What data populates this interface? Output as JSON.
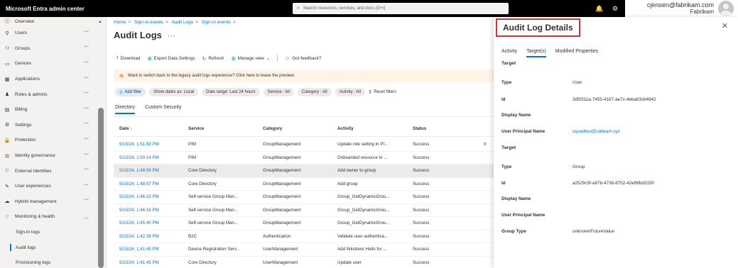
{
  "topbar": {
    "brand": "Microsoft Entra admin center",
    "search_placeholder": "Search resources, services, and docs (G+/)",
    "user_email": "cjensen@fabrikam.com",
    "user_org": "Fabrikam"
  },
  "sidebar": {
    "items": [
      {
        "label": "Overview",
        "icon": "info-icon",
        "glyph": "ⓘ",
        "chevron": false
      },
      {
        "label": "Users",
        "icon": "user-icon",
        "glyph": "⚲",
        "chevron": true
      },
      {
        "label": "Groups",
        "icon": "groups-icon",
        "glyph": "⚇",
        "chevron": true
      },
      {
        "label": "Devices",
        "icon": "devices-icon",
        "glyph": "▭",
        "chevron": true
      },
      {
        "label": "Applications",
        "icon": "applications-icon",
        "glyph": "▦",
        "chevron": true
      },
      {
        "label": "Roles & admins",
        "icon": "roles-icon",
        "glyph": "♟",
        "chevron": true
      },
      {
        "label": "Billing",
        "icon": "billing-icon",
        "glyph": "▤",
        "chevron": true
      },
      {
        "label": "Settings",
        "icon": "settings-icon",
        "glyph": "⚙",
        "chevron": true
      },
      {
        "label": "Protection",
        "icon": "protection-icon",
        "glyph": "🔒",
        "chevron": true
      },
      {
        "label": "Identity governance",
        "icon": "governance-icon",
        "glyph": "⚖",
        "chevron": true
      },
      {
        "label": "External Identities",
        "icon": "external-identities-icon",
        "glyph": "⚐",
        "chevron": true
      },
      {
        "label": "User experiences",
        "icon": "user-experiences-icon",
        "glyph": "✎",
        "chevron": true
      },
      {
        "label": "Hybrid management",
        "icon": "hybrid-icon",
        "glyph": "☁",
        "chevron": true
      },
      {
        "label": "Monitoring & health",
        "icon": "monitoring-icon",
        "glyph": "♡",
        "chevron": true,
        "expanded": true
      }
    ],
    "subitems": [
      "Sign-in logs",
      "Audit logs",
      "Provisioning logs"
    ]
  },
  "main": {
    "breadcrumb": [
      "Home",
      "Sign-in events",
      "Audit Logs",
      "Sign-in events"
    ],
    "title": "Audit Logs",
    "toolbar": {
      "download": "Download",
      "export": "Export Data Settings",
      "refresh": "Refresh",
      "manage_view": "Manage view",
      "feedback": "Got feedback?"
    },
    "banner": "Want to switch back to the legacy audit logs experience? Click here to leave the preview.",
    "filters": {
      "add": "Add filter",
      "show_dates": "Show dates as: Local",
      "date_range": "Date range: Last 24 hours",
      "service": "Service : All",
      "category": "Category : All",
      "activity": "Activity : All",
      "reset": "Reset filters"
    },
    "tabs": [
      "Directory",
      "Custom Security"
    ],
    "table": {
      "headers": [
        "Date ↓",
        "Service",
        "Category",
        "Activity",
        "Status"
      ],
      "rows": [
        [
          "5/15/24, 1:51:59 PM",
          "PIM",
          "GroupManagement",
          "Update role setting in PI...",
          "Success",
          "Ir"
        ],
        [
          "5/15/24, 1:50:14 PM",
          "PIM",
          "GroupManagement",
          "Onboarded resource to ...",
          "Success",
          ""
        ],
        [
          "5/15/24, 1:48:09 PM",
          "Core Directory",
          "GroupManagement",
          "Add owner to group",
          "Success",
          ""
        ],
        [
          "5/15/24, 1:48:07 PM",
          "Core Directory",
          "GroupManagement",
          "Add group",
          "Success",
          ""
        ],
        [
          "5/15/24, 1:46:19 PM",
          "Self-service Group Man...",
          "GroupManagement",
          "Group_GetDynamicGrou...",
          "Success",
          ""
        ],
        [
          "5/15/24, 1:46:16 PM",
          "Self-service Group Man...",
          "GroupManagement",
          "Group_GetDynamicGrou...",
          "Success",
          ""
        ],
        [
          "5/15/24, 1:45:40 PM",
          "Self-service Group Man...",
          "GroupManagement",
          "Group_GetDynamicGrou...",
          "Success",
          ""
        ],
        [
          "5/15/24, 1:42:28 PM",
          "B2C",
          "Authentication",
          "Validate user authentica...",
          "Success",
          ""
        ],
        [
          "5/15/24, 1:41:45 PM",
          "Device Registration Serv...",
          "UserManagement",
          "Add Windows Hello for ...",
          "Success",
          ""
        ],
        [
          "5/15/24, 1:41:45 PM",
          "Core Directory",
          "UserManagement",
          "Update user",
          "Success",
          ""
        ]
      ],
      "selected_row": 2
    }
  },
  "panel": {
    "title": "Audit Log Details",
    "tabs": [
      "Activity",
      "Target(s)",
      "Modified Properties"
    ],
    "active_tab": 1,
    "sections": [
      {
        "heading": "Target",
        "rows": [
          {
            "label": "Type",
            "value": "User"
          },
          {
            "label": "Id",
            "value": "3d5f311a-7455-4167-ae7c-4eba03cb4942"
          },
          {
            "label": "Display Name",
            "value": ""
          },
          {
            "label": "User Principal Name",
            "value": "squadtwo@catteam.xyz",
            "link": true
          }
        ]
      },
      {
        "heading": "Target",
        "rows": [
          {
            "label": "Type",
            "value": "Group"
          },
          {
            "label": "Id",
            "value": "a2529c5f-a97b-4736-8752-42ef6fbd3150"
          },
          {
            "label": "Display Name",
            "value": ""
          },
          {
            "label": "User Principal Name",
            "value": ""
          },
          {
            "label": "Group Type",
            "value": "unknownFutureValue"
          }
        ]
      }
    ]
  },
  "colors": {
    "accent": "#0078d4",
    "highlight_border": "#d13438",
    "warning_bg": "#fff4e5"
  }
}
